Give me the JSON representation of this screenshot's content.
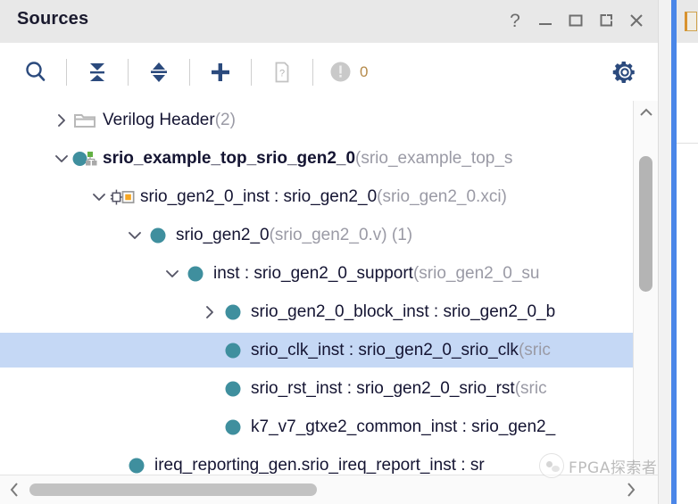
{
  "window": {
    "title": "Sources",
    "controls": [
      {
        "name": "help-button",
        "glyph": "?"
      },
      {
        "name": "minimize-button",
        "glyph": "_"
      },
      {
        "name": "maximize-button",
        "glyph": "square"
      },
      {
        "name": "float-button",
        "glyph": "float"
      },
      {
        "name": "close-button",
        "glyph": "x"
      }
    ]
  },
  "toolbar": {
    "search_label": "Search",
    "collapse_all_label": "Collapse All",
    "expand_collapse_label": "Expand/Collapse",
    "add_sources_label": "Add Sources",
    "help_doc_label": "Help",
    "messages_count": "0",
    "settings_label": "Settings"
  },
  "tree": {
    "rows": [
      {
        "indent": 58,
        "twisty": "right",
        "icon": "folder-icon",
        "label": "Verilog Header",
        "suffix": " (2)",
        "bold": false,
        "selected": false,
        "name": "tree-row-verilog-header"
      },
      {
        "indent": 58,
        "twisty": "down",
        "icon": "top-module-icon",
        "label": "srio_example_top_srio_gen2_0",
        "suffix": " (srio_example_top_s",
        "bold": true,
        "selected": false,
        "name": "tree-row-srio-example-top"
      },
      {
        "indent": 100,
        "twisty": "down",
        "icon": "ip-core-icon",
        "label": "srio_gen2_0_inst : srio_gen2_0",
        "suffix": " (srio_gen2_0.xci)",
        "bold": false,
        "selected": false,
        "name": "tree-row-srio-gen2-0-inst"
      },
      {
        "indent": 140,
        "twisty": "down",
        "icon": "module-icon",
        "label": "srio_gen2_0",
        "suffix": " (srio_gen2_0.v) (1)",
        "bold": false,
        "selected": false,
        "name": "tree-row-srio-gen2-0"
      },
      {
        "indent": 182,
        "twisty": "down",
        "icon": "module-icon",
        "label": "inst : srio_gen2_0_support",
        "suffix": " (srio_gen2_0_su",
        "bold": false,
        "selected": false,
        "name": "tree-row-inst-support"
      },
      {
        "indent": 224,
        "twisty": "right",
        "icon": "module-icon",
        "label": "srio_gen2_0_block_inst : srio_gen2_0_b",
        "suffix": "",
        "bold": false,
        "selected": false,
        "name": "tree-row-block-inst"
      },
      {
        "indent": 224,
        "twisty": "none",
        "icon": "module-icon",
        "label": "srio_clk_inst : srio_gen2_0_srio_clk",
        "suffix": " (sric",
        "bold": false,
        "selected": true,
        "name": "tree-row-srio-clk-inst"
      },
      {
        "indent": 224,
        "twisty": "none",
        "icon": "module-icon",
        "label": "srio_rst_inst : srio_gen2_0_srio_rst",
        "suffix": " (sric",
        "bold": false,
        "selected": false,
        "name": "tree-row-srio-rst-inst"
      },
      {
        "indent": 224,
        "twisty": "none",
        "icon": "module-icon",
        "label": "k7_v7_gtxe2_common_inst : srio_gen2_",
        "suffix": "",
        "bold": false,
        "selected": false,
        "name": "tree-row-gtxe2-common-inst"
      },
      {
        "indent": 116,
        "twisty": "none",
        "icon": "module-icon",
        "label": "ireq_reporting_gen.srio_ireq_report_inst : sr",
        "suffix": "",
        "bold": false,
        "selected": false,
        "name": "tree-row-ireq-report-inst"
      }
    ]
  },
  "scrollbars": {
    "vertical_label": "Vertical scrollbar",
    "horizontal_label": "Horizontal scrollbar"
  },
  "watermark": {
    "text": "FPGA探索者"
  },
  "colors": {
    "accent_blue": "#4a86e8",
    "selection": "#c5d8f5",
    "module_teal": "#3f8f9e",
    "ip_orange": "#f5a623",
    "icon_navy": "#2b4a7d",
    "titlebar_bg": "#e8e8e8"
  }
}
